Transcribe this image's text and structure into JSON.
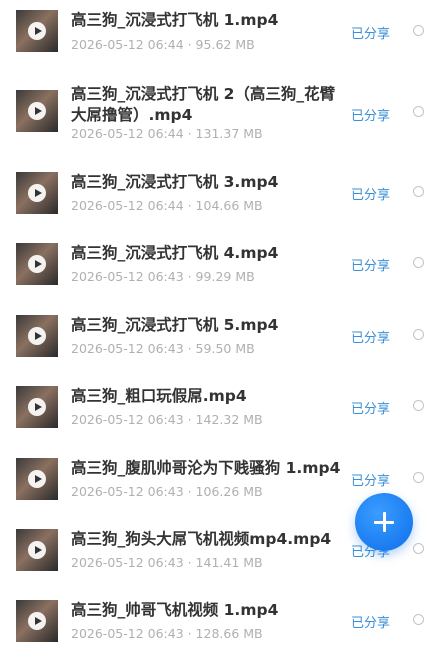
{
  "files": [
    {
      "title": "高三狗_沉浸式打飞机 1.mp4",
      "meta": "2026-05-12 06:44 · 95.62 MB",
      "status": "已分享"
    },
    {
      "title": "高三狗_沉浸式打飞机 2（高三狗_花臂大屌撸管）.mp4",
      "meta": "2026-05-12 06:44 · 131.37 MB",
      "status": "已分享"
    },
    {
      "title": "高三狗_沉浸式打飞机 3.mp4",
      "meta": "2026-05-12 06:44 · 104.66 MB",
      "status": "已分享"
    },
    {
      "title": "高三狗_沉浸式打飞机 4.mp4",
      "meta": "2026-05-12 06:43 · 99.29 MB",
      "status": "已分享"
    },
    {
      "title": "高三狗_沉浸式打飞机 5.mp4",
      "meta": "2026-05-12 06:43 · 59.50 MB",
      "status": "已分享"
    },
    {
      "title": "高三狗_粗口玩假屌.mp4",
      "meta": "2026-05-12 06:43 · 142.32 MB",
      "status": "已分享"
    },
    {
      "title": "高三狗_腹肌帅哥沦为下贱骚狗 1.mp4",
      "meta": "2026-05-12 06:43 · 106.26 MB",
      "status": "已分享"
    },
    {
      "title": "高三狗_狗头大屌飞机视频mp4.mp4",
      "meta": "2026-05-12 06:43 · 141.41 MB",
      "status": "已分享"
    },
    {
      "title": "高三狗_帅哥飞机视频 1.mp4",
      "meta": "2026-05-12 06:43 · 128.66 MB",
      "status": "已分享"
    }
  ],
  "icons": {
    "thumbnail_overlay": "play-icon",
    "select": "radio-circle-icon",
    "fab": "plus-icon"
  },
  "colors": {
    "shared_status": "#3a8fd8",
    "fab": "#1a7cf0",
    "title": "#333333",
    "meta": "#b0b0b0"
  }
}
